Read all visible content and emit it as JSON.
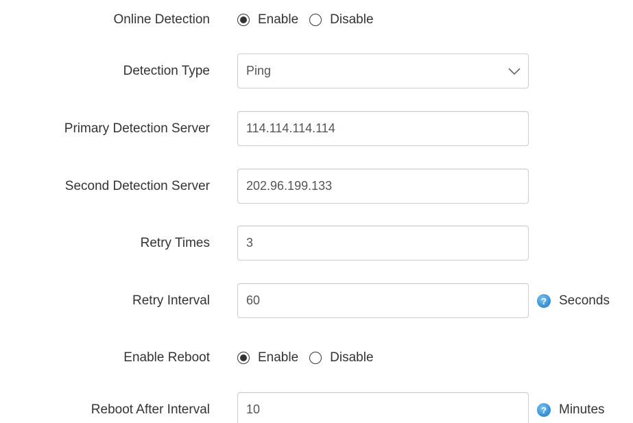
{
  "online_detection": {
    "label": "Online Detection",
    "options": [
      {
        "label": "Enable",
        "selected": true
      },
      {
        "label": "Disable",
        "selected": false
      }
    ]
  },
  "detection_type": {
    "label": "Detection Type",
    "value": "Ping"
  },
  "primary_server": {
    "label": "Primary Detection Server",
    "value": "114.114.114.114"
  },
  "second_server": {
    "label": "Second Detection Server",
    "value": "202.96.199.133"
  },
  "retry_times": {
    "label": "Retry Times",
    "value": "3"
  },
  "retry_interval": {
    "label": "Retry Interval",
    "value": "60",
    "unit": "Seconds",
    "help_icon": "question-circle-icon"
  },
  "enable_reboot": {
    "label": "Enable Reboot",
    "options": [
      {
        "label": "Enable",
        "selected": true
      },
      {
        "label": "Disable",
        "selected": false
      }
    ]
  },
  "reboot_interval": {
    "label": "Reboot After Interval",
    "value": "10",
    "unit": "Minutes",
    "help_icon": "question-circle-icon"
  },
  "colors": {
    "text": "#333333",
    "input_border": "#cccccc",
    "help_icon": "#3a93d6"
  }
}
